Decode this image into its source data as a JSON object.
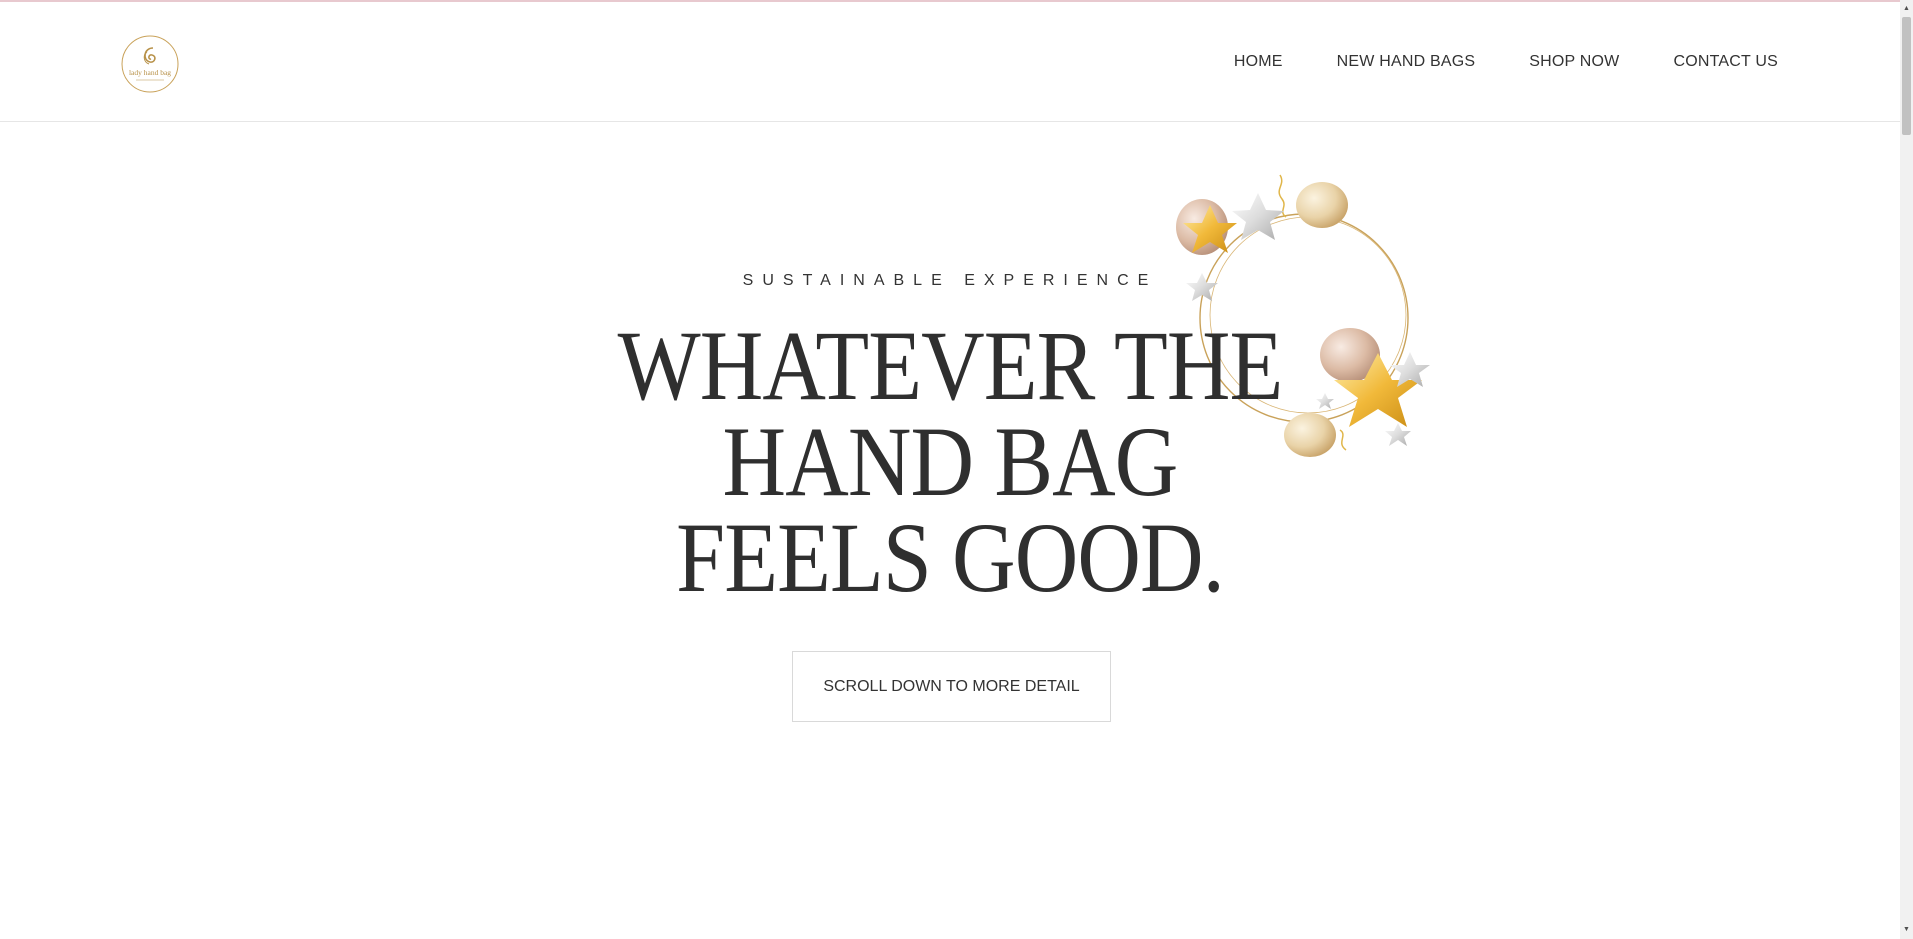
{
  "nav": {
    "items": [
      {
        "label": "HOME"
      },
      {
        "label": "NEW HAND BAGS"
      },
      {
        "label": "SHOP NOW"
      },
      {
        "label": "CONTACT US"
      }
    ]
  },
  "logo": {
    "text": "lady hand bag"
  },
  "hero": {
    "eyebrow": "SUSTAINABLE EXPERIENCE",
    "headline_lines": [
      "WHATEVER THE",
      "HAND BAG",
      "FEELS GOOD."
    ],
    "cta_label": "SCROLL DOWN TO MORE DETAIL"
  },
  "colors": {
    "accent_gold": "#c9a25a",
    "text": "#333333",
    "top_accent": "#e8c9cf"
  },
  "icons": {
    "logo": "brand-logo-icon",
    "decoration": "balloons-ring-icon"
  }
}
